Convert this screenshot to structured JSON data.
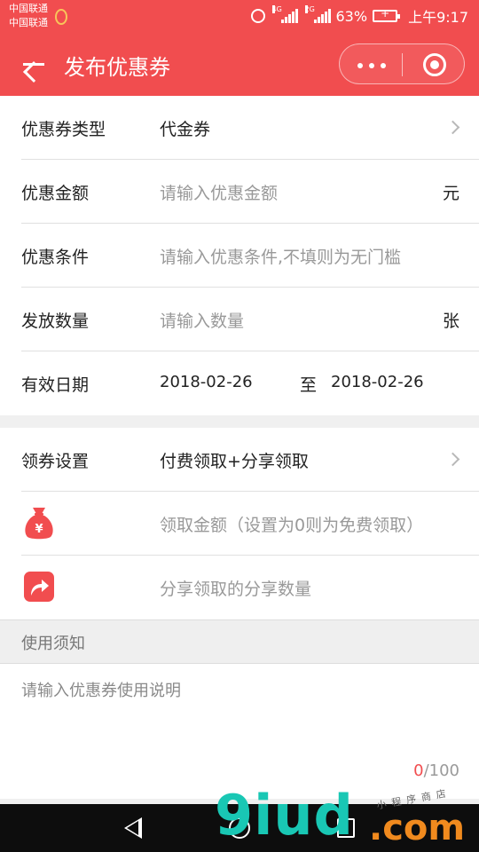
{
  "status_bar": {
    "carrier_1": "中国联通",
    "carrier_2": "中国联通",
    "net_1": "4G",
    "net_2": "2G",
    "battery": "63%",
    "time": "上午9:17"
  },
  "header": {
    "title": "发布优惠券",
    "back_icon": "arrow-left-icon",
    "more_icon": "more-dots-icon",
    "close_icon": "target-circle-icon"
  },
  "form": {
    "coupon_type": {
      "label": "优惠券类型",
      "value": "代金券"
    },
    "amount": {
      "label": "优惠金额",
      "placeholder": "请输入优惠金额",
      "unit": "元"
    },
    "condition": {
      "label": "优惠条件",
      "placeholder": "请输入优惠条件,不填则为无门槛"
    },
    "quantity": {
      "label": "发放数量",
      "placeholder": "请输入数量",
      "unit": "张"
    },
    "validity": {
      "label": "有效日期",
      "start": "2018-02-26",
      "separator": "至",
      "end": "2018-02-26"
    }
  },
  "claim": {
    "setting": {
      "label": "领券设置",
      "value": "付费领取+分享领取"
    },
    "fee": {
      "placeholder": "领取金额（设置为0则为免费领取）",
      "icon": "money-bag-icon"
    },
    "share": {
      "placeholder": "分享领取的分享数量",
      "icon": "share-arrow-icon"
    }
  },
  "notice": {
    "title": "使用须知",
    "placeholder": "请输入优惠券使用说明",
    "count": "0",
    "max": "/100"
  },
  "watermark": {
    "brand": "9iud",
    "domain": ".com",
    "tagline": "小程序商店"
  },
  "colors": {
    "accent": "#f14d4f",
    "watermark_green": "#19c7b4",
    "watermark_orange": "#f08a1e"
  }
}
